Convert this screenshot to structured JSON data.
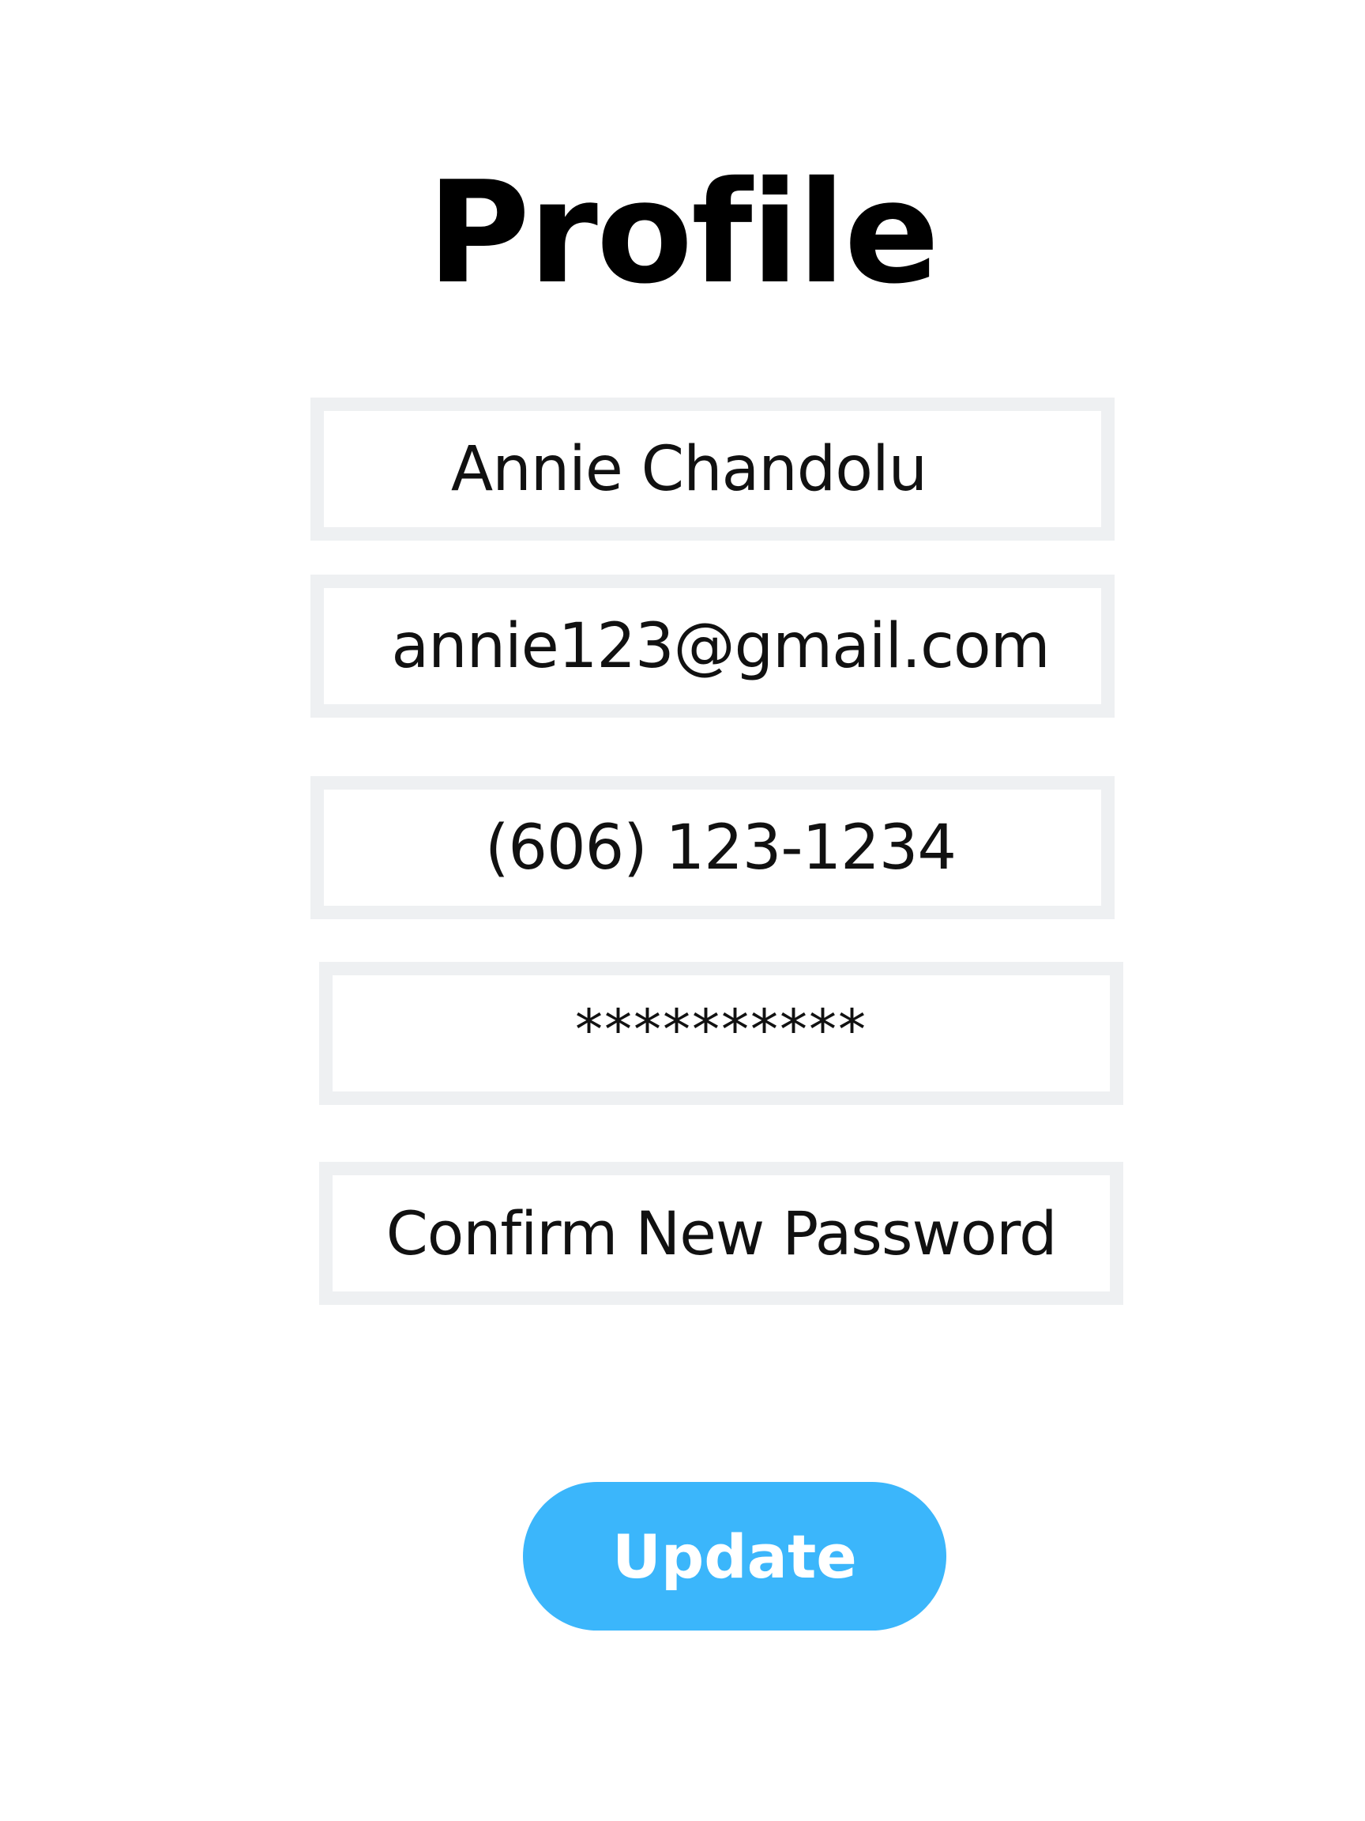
{
  "page": {
    "title": "Profile"
  },
  "form": {
    "name_value": "Annie Chandolu",
    "email_value": "annie123@gmail.com",
    "phone_value": "(606) 123-1234",
    "password_value": "**********",
    "confirm_password_placeholder": "Confirm New Password"
  },
  "actions": {
    "update_label": "Update"
  },
  "colors": {
    "field_border": "#eef0f2",
    "button_background": "#3bb6fb",
    "button_text": "#ffffff",
    "title_text": "#000000"
  }
}
